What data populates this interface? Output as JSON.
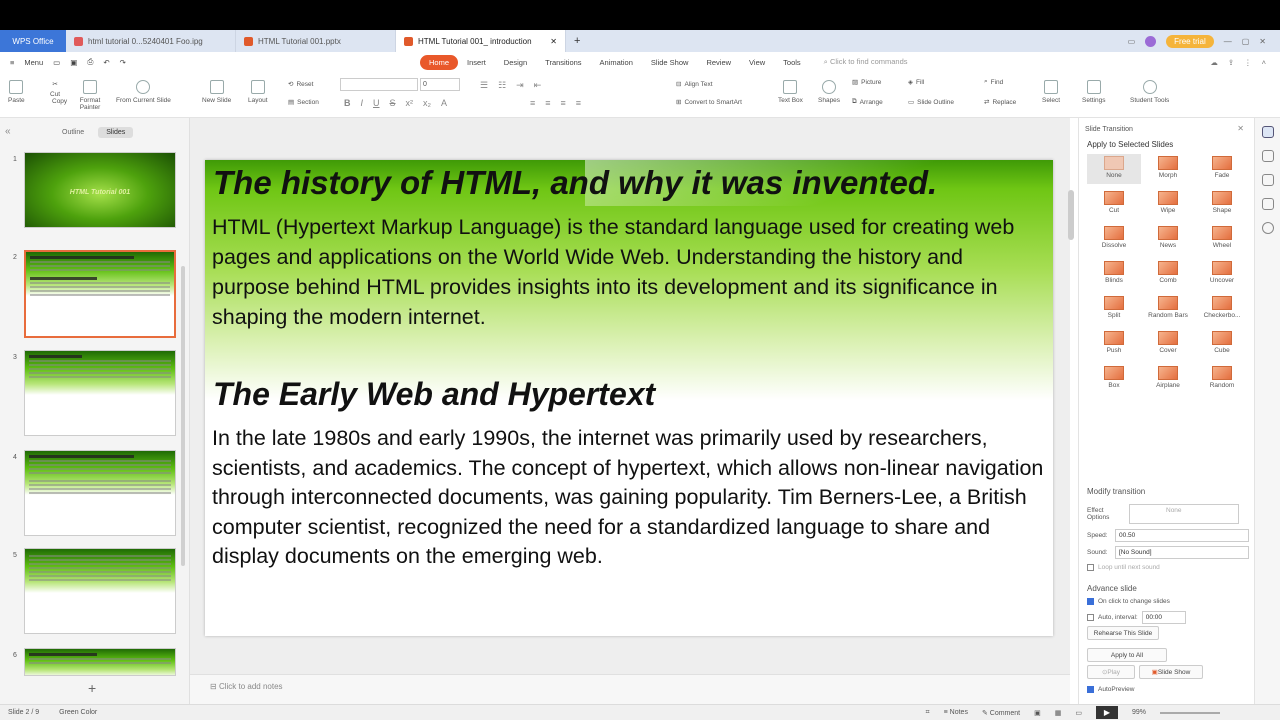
{
  "tabs": {
    "app": "WPS Office",
    "docs": [
      "html tutorial 0...5240401 Foo.ipg",
      "HTML Tutorial 001.pptx",
      "HTML Tutorial 001_ introduction"
    ],
    "freetrial": "Free trial"
  },
  "menu": {
    "menu_label": "Menu",
    "tabs": [
      "Home",
      "Insert",
      "Design",
      "Transitions",
      "Animation",
      "Slide Show",
      "Review",
      "View",
      "Tools"
    ],
    "find": "Click to find commands"
  },
  "ribbon": {
    "paste": "Paste",
    "cut": "Cut",
    "copy": "Copy",
    "format_painter": "Format Painter",
    "from_current": "From Current Slide",
    "new_slide": "New Slide",
    "layout": "Layout",
    "reset": "Reset",
    "section": "Section",
    "font_size": "0",
    "align_text": "Align Text",
    "convert_smartart": "Convert to SmartArt",
    "text_box": "Text Box",
    "shapes": "Shapes",
    "picture": "Picture",
    "arrange": "Arrange",
    "fill": "Fill",
    "slide_outline": "Slide Outline",
    "find": "Find",
    "replace": "Replace",
    "select": "Select",
    "settings": "Settings",
    "student_tools": "Student Tools"
  },
  "left_panel": {
    "outline_tab": "Outline",
    "slides_tab": "Slides",
    "thumb1_title": "HTML Tutorial 001",
    "thumb_numbers": [
      "1",
      "2",
      "3",
      "4",
      "5",
      "6"
    ]
  },
  "slide": {
    "heading1": "The history of HTML, and why it was invented.",
    "para1": "HTML (Hypertext Markup Language) is the standard language used for creating web pages and applications on the World Wide Web. Understanding the history and purpose behind HTML provides insights into its development and its significance in shaping the modern internet.",
    "heading2": "The Early Web and Hypertext",
    "para2": "In the late 1980s and early 1990s, the internet was primarily used by researchers, scientists, and academics. The concept of hypertext, which allows non-linear navigation through interconnected documents, was gaining popularity. Tim Berners-Lee, a British computer scientist, recognized the need for a standardized language to share and display documents on the emerging web."
  },
  "notes": {
    "placeholder": "Click to add notes"
  },
  "right_panel": {
    "header": "Slide Transition",
    "apply_label": "Apply to Selected Slides",
    "transitions": [
      "None",
      "Morph",
      "Fade",
      "Cut",
      "Wipe",
      "Shape",
      "Dissolve",
      "News",
      "Wheel",
      "Blinds",
      "Comb",
      "Uncover",
      "Split",
      "Random Bars",
      "Checkerbo...",
      "Push",
      "Cover",
      "Cube",
      "Box",
      "Airplane",
      "Random"
    ],
    "modify": "Modify transition",
    "effect_label": "Effect Options",
    "effect_value": "None",
    "speed_label": "Speed:",
    "speed_value": "00.50",
    "sound_label": "Sound:",
    "sound_value": "[No Sound]",
    "loop": "Loop until next sound",
    "advance": "Advance slide",
    "on_click": "On click to change slides",
    "auto": "Auto, interval:",
    "auto_value": "00:00",
    "rehearse": "Rehearse This Slide",
    "apply_all": "Apply to All",
    "play": "Play",
    "slideshow": "Slide Show",
    "autopreview": "AutoPreview"
  },
  "status": {
    "slide_counter": "Slide 2 / 9",
    "theme": "Green Color",
    "notes": "Notes",
    "comment": "Comment",
    "zoom": "99%"
  }
}
